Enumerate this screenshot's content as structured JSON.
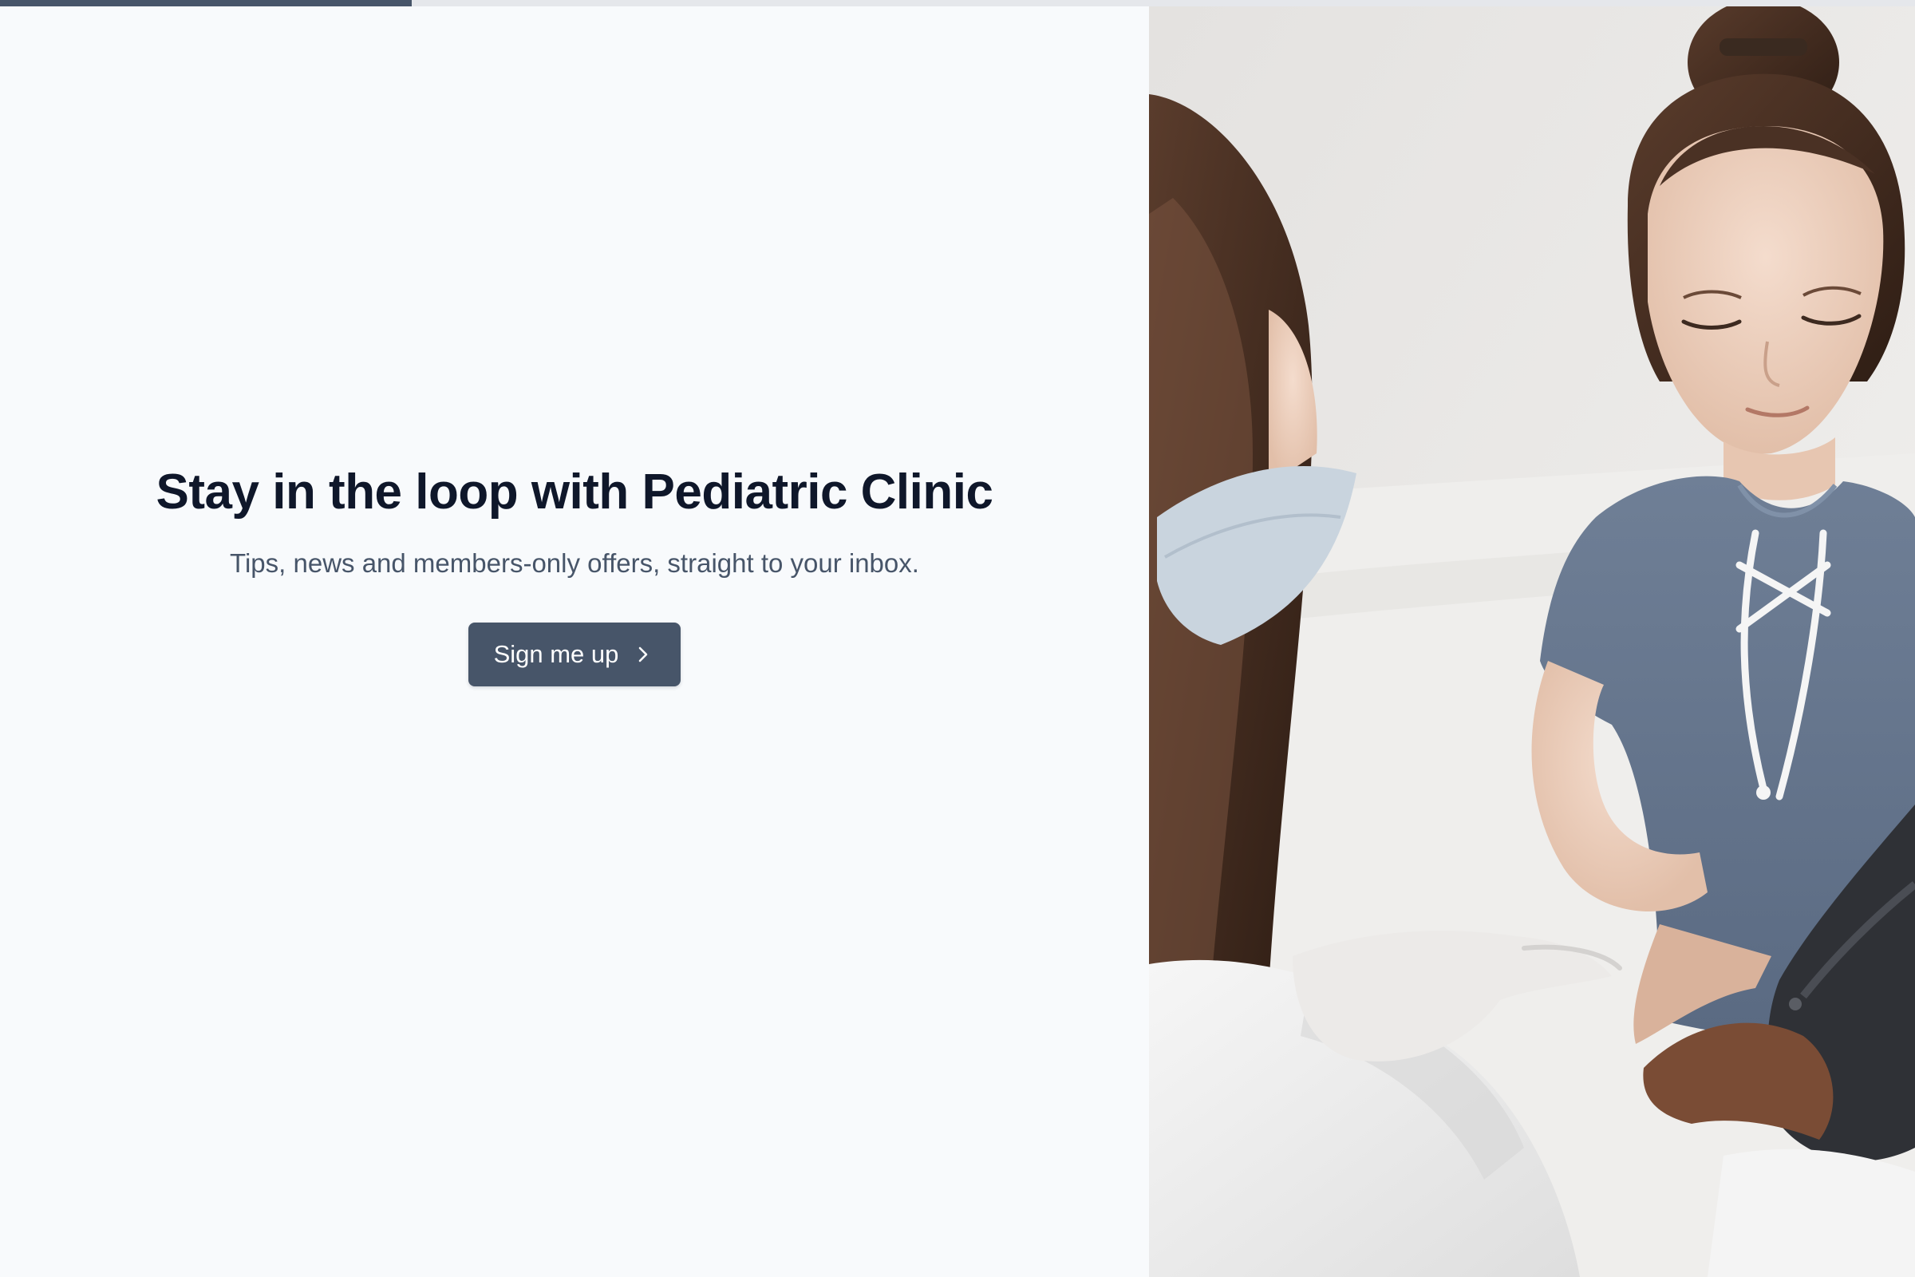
{
  "progress": {
    "fraction": 0.215
  },
  "hero": {
    "headline": "Stay in the loop with Pediatric Clinic",
    "subtext": "Tips, news and members-only offers, straight to your inbox.",
    "cta_label": "Sign me up",
    "cta_icon": "chevron-right-icon"
  },
  "photo": {
    "subject": "clinic-photo"
  },
  "colors": {
    "accent": "#475569",
    "heading": "#0f172a",
    "body_text": "#475569",
    "background": "#f8fafc"
  }
}
